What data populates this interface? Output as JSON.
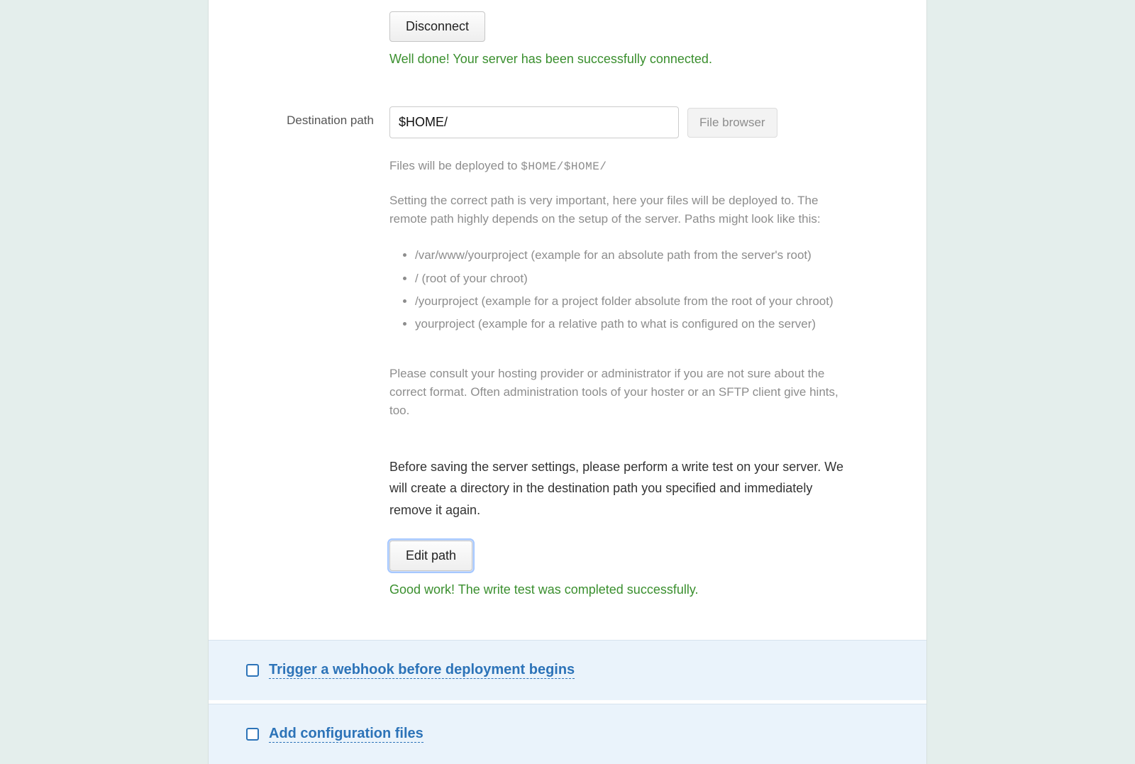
{
  "connection": {
    "disconnect_button": "Disconnect",
    "success_message": "Well done! Your server has been successfully connected."
  },
  "destination": {
    "label": "Destination path",
    "input_value": "$HOME/",
    "file_browser_button": "File browser",
    "deploy_hint_prefix": "Files will be deployed to ",
    "deploy_hint_path": "$HOME/$HOME/",
    "help_intro": "Setting the correct path is very important, here your files will be deployed to. The remote path highly depends on the setup of the server. Paths might look like this:",
    "examples": [
      "/var/www/yourproject (example for an absolute path from the server's root)",
      "/ (root of your chroot)",
      "/yourproject (example for a project folder absolute from the root of your chroot)",
      "yourproject (example for a relative path to what is configured on the server)"
    ],
    "help_outro": "Please consult your hosting provider or administrator if you are not sure about the correct format. Often administration tools of your hoster or an SFTP client give hints, too.",
    "write_test_info": "Before saving the server settings, please perform a write test on your server. We will create a directory in the destination path you specified and immediately remove it again.",
    "edit_path_button": "Edit path",
    "write_test_success": "Good work! The write test was completed successfully."
  },
  "sections": {
    "webhook": "Trigger a webhook before deployment begins",
    "config_files": "Add configuration files"
  }
}
